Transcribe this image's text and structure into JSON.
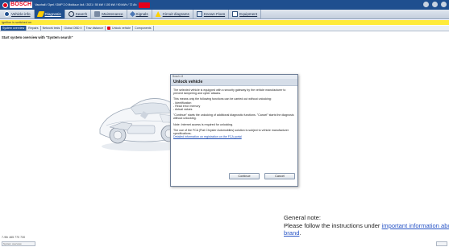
{
  "titlebar": {
    "brand": "BOSCH",
    "vehicle_info": "Vauxhall / Opel / GMP 2.0 Mokka-e 4x4 / 2021 / 50 kW / 100 kW / 90 kWh / 72 Ah"
  },
  "nav": {
    "tabs": [
      {
        "label": "Vehicle info"
      },
      {
        "label": "Diagnosis"
      },
      {
        "label": "Search"
      },
      {
        "label": "Maintenance"
      },
      {
        "label": "Signals"
      },
      {
        "label": "Circuit diagrams"
      },
      {
        "label": "Known Fixes"
      },
      {
        "label": "Equipment"
      }
    ]
  },
  "ignition_note": "Ignition is switched on",
  "subtabs": [
    {
      "label": "System overview"
    },
    {
      "label": "Repairs"
    },
    {
      "label": "Network tests"
    },
    {
      "label": "Global OBD II"
    },
    {
      "label": "Trav distance"
    },
    {
      "label": "Unlock vehicle"
    },
    {
      "label": "Components"
    }
  ],
  "main": {
    "heading": "Start system overview with \"System search\""
  },
  "dialog": {
    "window_title": "Bosch v3",
    "title": "Unlock vehicle",
    "p1": "The selected vehicle is equipped with a security gateway by the vehicle manufacturer to prevent tampering and cyber attacks.",
    "p2_intro": "This means only the following functions can be carried out without unlocking:",
    "list": [
      "- Identification",
      "- Read error memory",
      "- Actual values"
    ],
    "p3": "\"Continue\" starts the unlocking of additional diagnostic functions. \"Cancel\" starts the diagnosis without unlocking.",
    "p4": "Note: Internet access is required for unlocking.",
    "p5": "The use of the FCA (Fiat Chrysler Automobiles) solution is subject to vehicle manufacturer specifications.",
    "link": "Detailed information on registration on the FCA portal",
    "continue_label": "Continue",
    "cancel_label": "Cancel"
  },
  "note": {
    "title": "General note:",
    "text_before": "Please follow the instructions under ",
    "link": "important information about the",
    "link2": "brand",
    "text_after": "."
  },
  "status": {
    "line1": "7-9th 465 770 730",
    "box_text": "System overview"
  },
  "colors": {
    "accent_blue": "#1f4f8f",
    "bosch_red": "#e3001b",
    "ignition_yellow": "#ffeb3b"
  }
}
